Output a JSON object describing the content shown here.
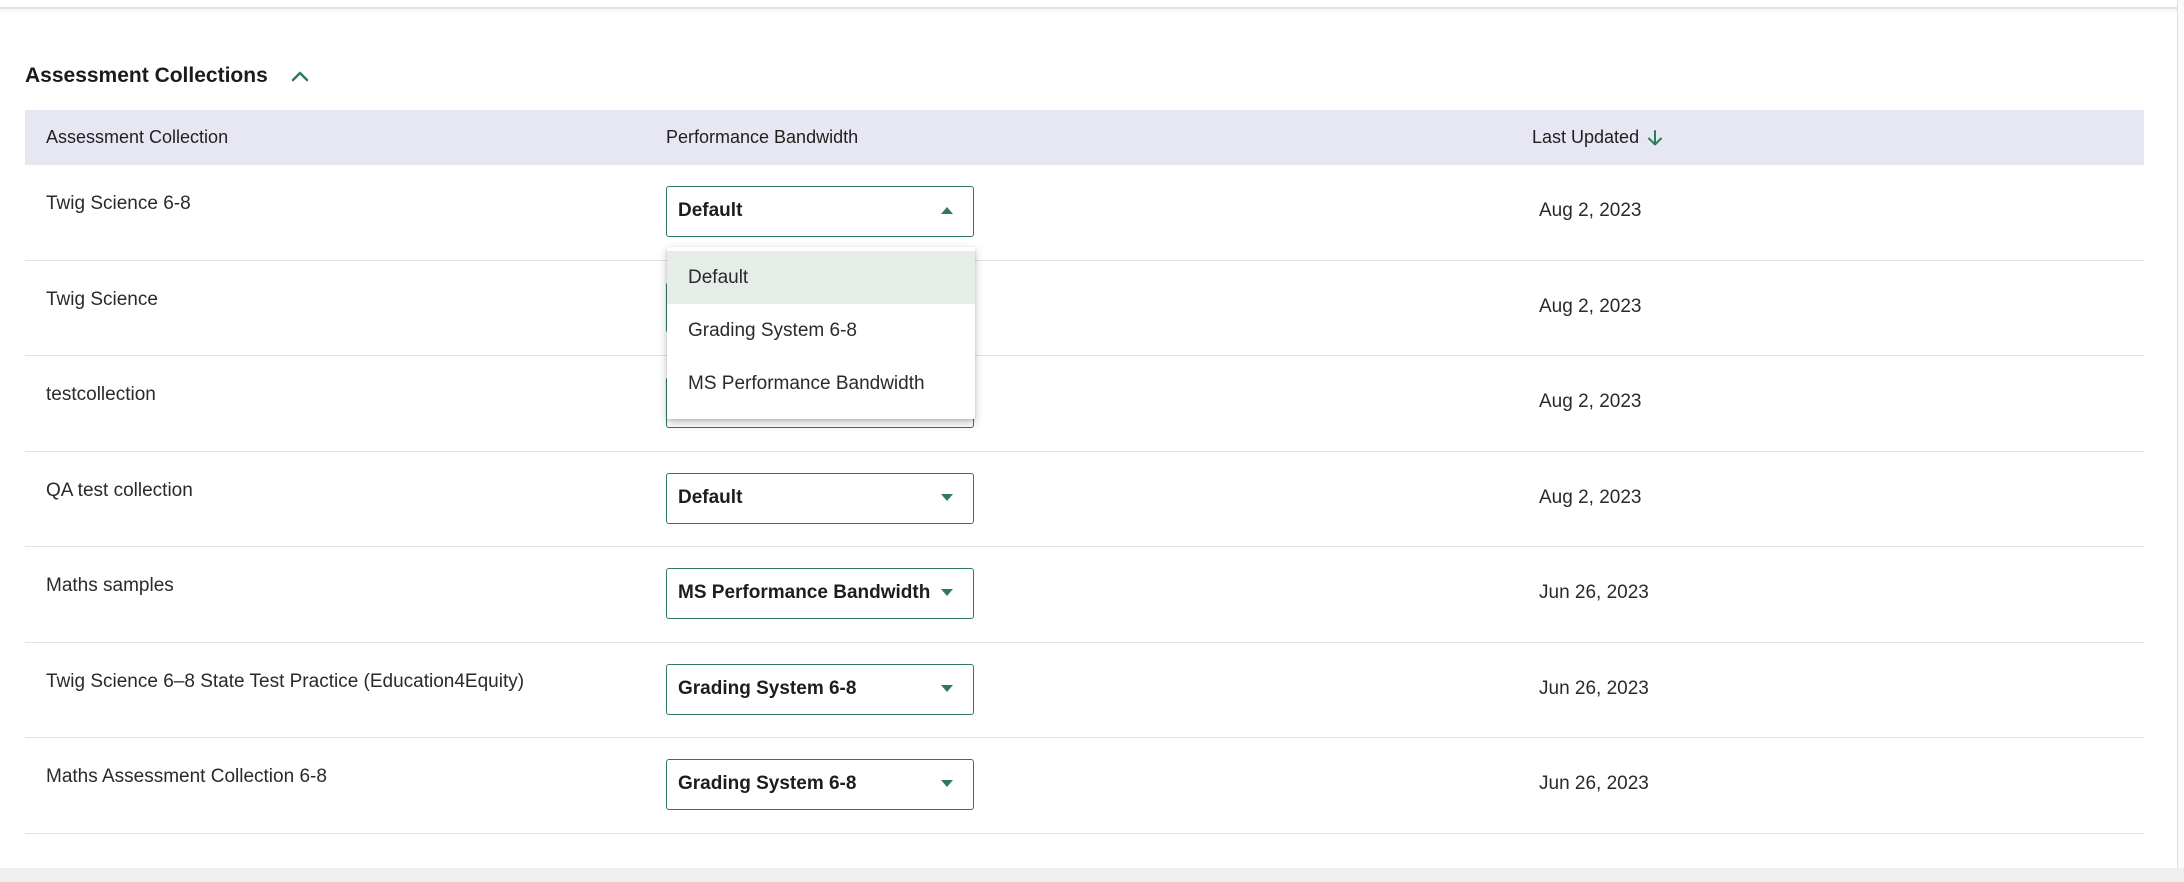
{
  "section": {
    "title": "Assessment Collections"
  },
  "table": {
    "columns": {
      "collection": "Assessment Collection",
      "bandwidth": "Performance Bandwidth",
      "updated": "Last Updated"
    },
    "rows": [
      {
        "name": "Twig Science 6-8",
        "bandwidth": "Default",
        "updated": "Aug 2, 2023"
      },
      {
        "name": "Twig Science",
        "bandwidth": "",
        "updated": "Aug 2, 2023"
      },
      {
        "name": "testcollection",
        "bandwidth": "",
        "updated": "Aug 2, 2023"
      },
      {
        "name": "QA test collection",
        "bandwidth": "Default",
        "updated": "Aug 2, 2023"
      },
      {
        "name": "Maths samples",
        "bandwidth": "MS Performance Bandwidth",
        "updated": "Jun 26, 2023"
      },
      {
        "name": "Twig Science 6–8 State Test Practice (Education4Equity)",
        "bandwidth": "Grading System 6-8",
        "updated": "Jun 26, 2023"
      },
      {
        "name": "Maths Assessment Collection 6-8",
        "bandwidth": "Grading System 6-8",
        "updated": "Jun 26, 2023"
      }
    ]
  },
  "dropdown": {
    "options": [
      "Default",
      "Grading System 6-8",
      "MS Performance Bandwidth"
    ],
    "selected": "Default"
  },
  "icons": {
    "collapse": "chevron-up-icon",
    "sort": "arrow-down-icon",
    "select_open": "caret-up-icon",
    "select_closed": "caret-down-icon"
  },
  "colors": {
    "accent": "#2f7a5f",
    "header_bg": "#e7e7f3",
    "selected_option_bg": "#e6ede9"
  }
}
